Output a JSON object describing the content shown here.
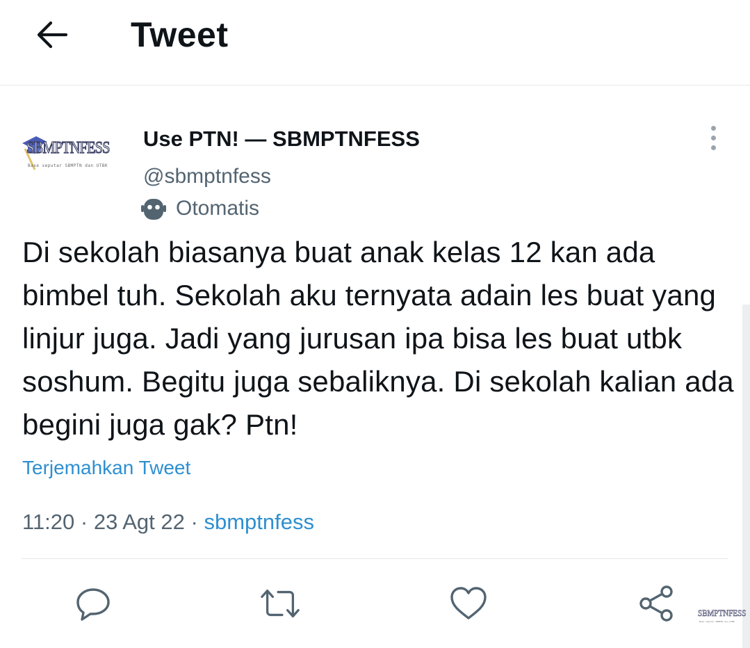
{
  "header": {
    "title": "Tweet",
    "back_icon": "arrow-left-icon"
  },
  "author": {
    "avatar_logo": "SBMPTNFESS",
    "avatar_tagline": "Base seputar SBMPTN dan UTBK",
    "display_name": "Use PTN! — SBMPTNFESS",
    "handle": "@sbmptnfess",
    "automated_label": "Otomatis",
    "automated_icon": "robot-icon"
  },
  "tweet": {
    "text": "Di sekolah biasanya buat anak kelas 12 kan ada bimbel tuh. Sekolah aku ternyata adain les buat yang linjur juga. Jadi yang jurusan ipa bisa les buat utbk soshum. Begitu juga sebaliknya. Di sekolah kalian ada begini juga gak? Ptn!",
    "translate_label": "Terjemahkan Tweet",
    "time": "11:20",
    "date": "23 Agt 22",
    "separator": "·",
    "source": "sbmptnfess"
  },
  "actions": [
    {
      "name": "reply",
      "icon": "reply-icon"
    },
    {
      "name": "retweet",
      "icon": "retweet-icon"
    },
    {
      "name": "like",
      "icon": "heart-icon"
    },
    {
      "name": "share",
      "icon": "share-icon"
    }
  ],
  "watermark": {
    "text": "SBMPTNFESS",
    "tagline": "Base seputar SBMPTN dan UTBK"
  },
  "colors": {
    "text": "#0f1419",
    "secondary": "#536471",
    "link": "#2e8fd0",
    "border": "#e7e9ea"
  }
}
